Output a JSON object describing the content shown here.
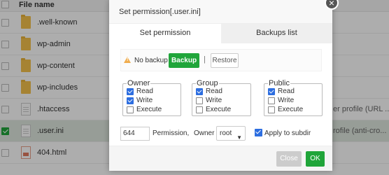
{
  "file_list": {
    "header": "File name",
    "rows": [
      {
        "name": ".well-known",
        "type": "folder",
        "extra": "",
        "selected": false
      },
      {
        "name": "wp-admin",
        "type": "folder",
        "extra": "",
        "selected": false
      },
      {
        "name": "wp-content",
        "type": "folder",
        "extra": "",
        "selected": false
      },
      {
        "name": "wp-includes",
        "type": "folder",
        "extra": "",
        "selected": false
      },
      {
        "name": ".htaccess",
        "type": "file",
        "extra": "er profile (URL ...",
        "selected": false
      },
      {
        "name": ".user.ini",
        "type": "file",
        "extra": "rofile (anti-cro...",
        "selected": true
      },
      {
        "name": "404.html",
        "type": "html",
        "extra": "",
        "selected": false
      }
    ]
  },
  "dialog": {
    "title": "Set permission[.user.ini]",
    "close_icon": "close-icon",
    "tabs": [
      {
        "label": "Set permission",
        "active": true
      },
      {
        "label": "Backups list",
        "active": false
      }
    ],
    "backup": {
      "status": "No backup",
      "backup_label": "Backup",
      "separator": "|",
      "restore_label": "Restore"
    },
    "groups": {
      "owner": {
        "legend": "Owner",
        "read": "Read",
        "write": "Write",
        "execute": "Execute",
        "read_checked": true,
        "write_checked": true,
        "execute_checked": false
      },
      "group": {
        "legend": "Group",
        "read": "Read",
        "write": "Write",
        "execute": "Execute",
        "read_checked": true,
        "write_checked": false,
        "execute_checked": false
      },
      "public": {
        "legend": "Public",
        "read": "Read",
        "write": "Write",
        "execute": "Execute",
        "read_checked": true,
        "write_checked": false,
        "execute_checked": false
      }
    },
    "permission_value": "644",
    "permission_label": "Permission,",
    "owner_label": "Owner",
    "owner_value": "root",
    "apply_subdir_label": "Apply to subdir",
    "apply_subdir_checked": true,
    "close_label": "Close",
    "ok_label": "OK"
  },
  "colors": {
    "accent_green": "#20a53a",
    "checkbox_blue": "#2d6ee0",
    "warning": "#f0ad4e"
  }
}
